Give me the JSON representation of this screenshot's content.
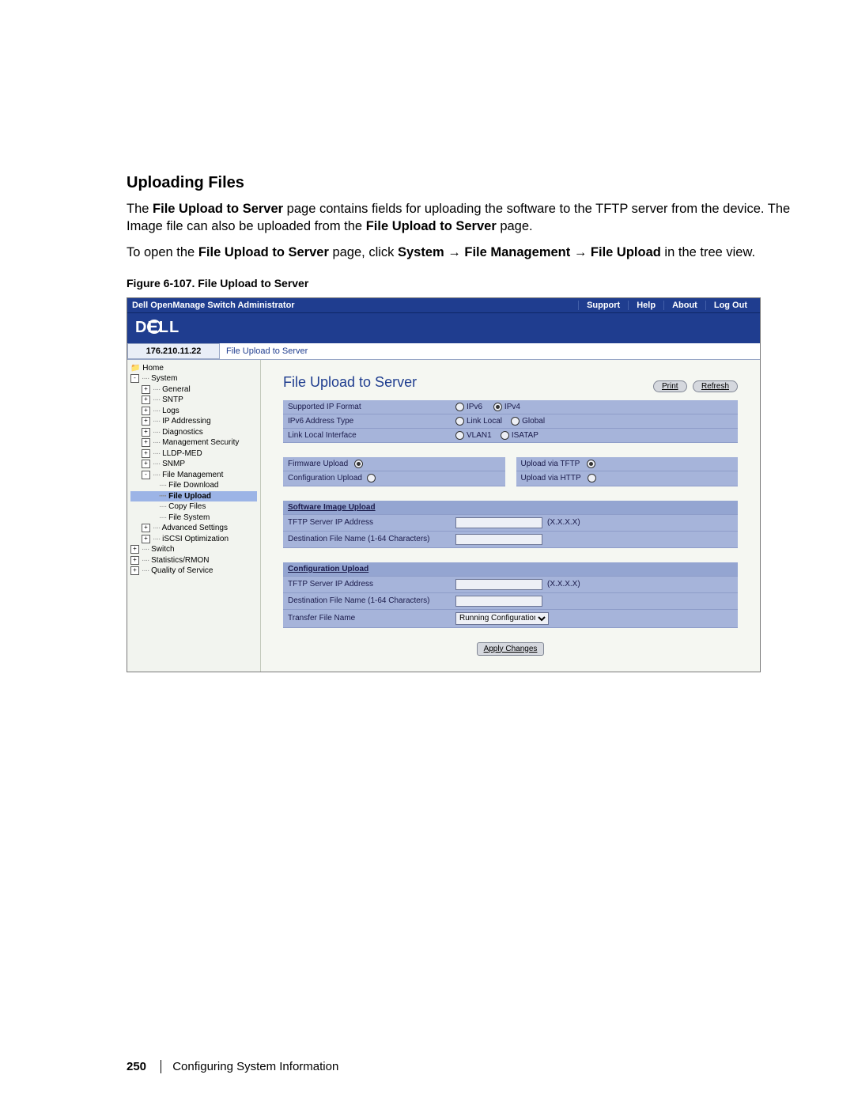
{
  "doc": {
    "heading": "Uploading Files",
    "para1_a": "The ",
    "para1_b": "File Upload to Server",
    "para1_c": " page contains fields for uploading the software to the TFTP server from the device. The Image file can also be uploaded from the ",
    "para1_d": "File Upload to Server",
    "para1_e": " page.",
    "para2_a": "To open the ",
    "para2_b": "File Upload to Server",
    "para2_c": " page, click ",
    "para2_d": "System",
    "para2_e": " → ",
    "para2_f": "File Management",
    "para2_g": " → ",
    "para2_h": "File Upload",
    "para2_i": " in the tree view.",
    "figcaption": "Figure 6-107.    File Upload to Server",
    "pagenum": "250",
    "footer": "Configuring System Information"
  },
  "app": {
    "title": "Dell OpenManage Switch Administrator",
    "nav": {
      "support": "Support",
      "help": "Help",
      "about": "About",
      "logout": "Log Out"
    },
    "ip": "176.210.11.22",
    "crumb": "File Upload to Server"
  },
  "tree": {
    "home": "Home",
    "system": "System",
    "general": "General",
    "sntp": "SNTP",
    "logs": "Logs",
    "ipaddr": "IP Addressing",
    "diag": "Diagnostics",
    "mgmtsec": "Management Security",
    "lldp": "LLDP-MED",
    "snmp": "SNMP",
    "filemgmt": "File Management",
    "filedl": "File Download",
    "fileul": "File Upload",
    "copy": "Copy Files",
    "filesys": "File System",
    "advset": "Advanced Settings",
    "iscsi": "iSCSI Optimization",
    "switch": "Switch",
    "stats": "Statistics/RMON",
    "qos": "Quality of Service"
  },
  "main": {
    "title": "File Upload to Server",
    "print": "Print",
    "refresh": "Refresh",
    "ipfmt_lbl": "Supported IP Format",
    "ipv6": "IPv6",
    "ipv4": "IPv4",
    "v6type_lbl": "IPv6 Address Type",
    "linklocal": "Link Local",
    "global": "Global",
    "llif_lbl": "Link Local Interface",
    "vlan1": "VLAN1",
    "isatap": "ISATAP",
    "fw_upload": "Firmware Upload",
    "cfg_upload": "Configuration Upload",
    "via_tftp": "Upload via TFTP",
    "via_http": "Upload via HTTP",
    "sw_hdr": "Software Image Upload",
    "tftp_ip": "TFTP Server IP Address",
    "xxxx": "(X.X.X.X)",
    "dest_fn": "Destination File Name (1-64 Characters)",
    "cfg_hdr": "Configuration Upload",
    "xfer_fn": "Transfer File Name",
    "running": "Running Configuration",
    "apply": "Apply Changes"
  }
}
